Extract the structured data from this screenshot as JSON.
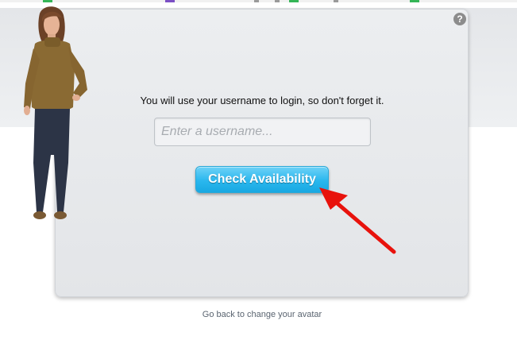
{
  "instruction_text": "You will use your username to login, so don't forget it.",
  "username_field": {
    "placeholder": "Enter a username...",
    "value": ""
  },
  "check_button_label": "Check Availability",
  "back_link_text": "Go back to change your avatar",
  "help_icon": {
    "icon": "help-icon",
    "glyph": "?"
  },
  "colors": {
    "button": "#2ab7ee",
    "arrow": "#e8120c",
    "panel": "#e6e8eb"
  }
}
